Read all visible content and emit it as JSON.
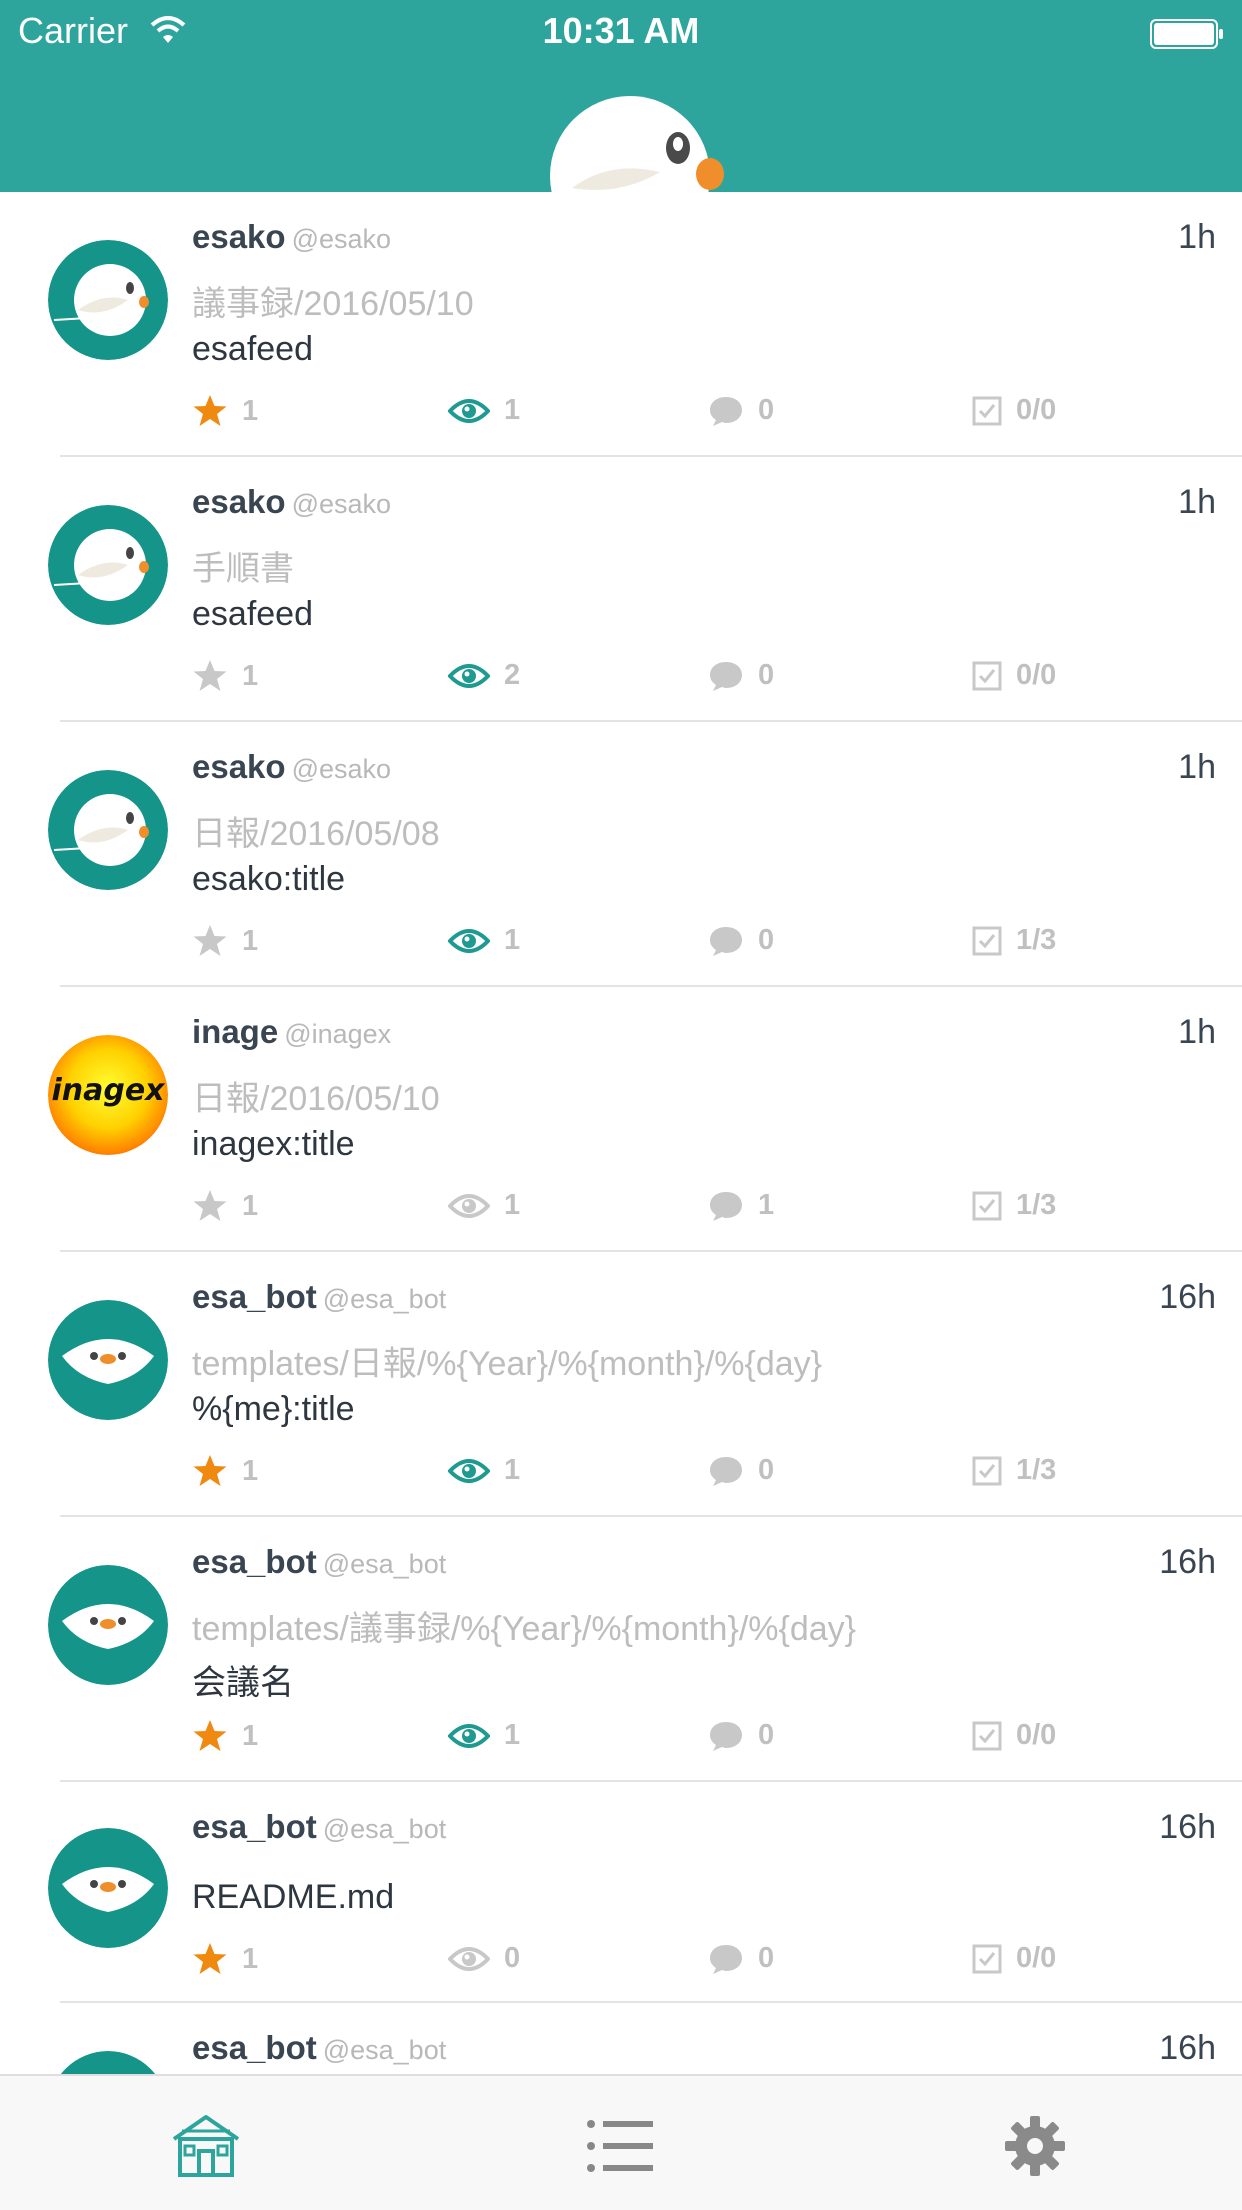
{
  "status_bar": {
    "carrier": "Carrier",
    "time": "10:31 AM"
  },
  "colors": {
    "primary": "#2da59d",
    "star_active": "#f0890f",
    "watch_active": "#1f9a91",
    "inactive": "#c8c8c8"
  },
  "posts": [
    {
      "name": "esako",
      "handle": "@esako",
      "time": "1h",
      "category": "議事録/2016/05/10",
      "title": "esafeed",
      "stars": "1",
      "watchers": "1",
      "comments": "0",
      "tasks": "0/0",
      "starred": true,
      "watched": true,
      "avatar": "esa-bird-icon"
    },
    {
      "name": "esako",
      "handle": "@esako",
      "time": "1h",
      "category": "手順書",
      "title": "esafeed",
      "stars": "1",
      "watchers": "2",
      "comments": "0",
      "tasks": "0/0",
      "starred": false,
      "watched": true,
      "avatar": "esa-bird-icon"
    },
    {
      "name": "esako",
      "handle": "@esako",
      "time": "1h",
      "category": "日報/2016/05/08",
      "title": "esako:title",
      "stars": "1",
      "watchers": "1",
      "comments": "0",
      "tasks": "1/3",
      "starred": false,
      "watched": true,
      "avatar": "esa-bird-icon"
    },
    {
      "name": "inage",
      "handle": "@inagex",
      "time": "1h",
      "category": "日報/2016/05/10",
      "title": "inagex:title",
      "stars": "1",
      "watchers": "1",
      "comments": "1",
      "tasks": "1/3",
      "starred": false,
      "watched": false,
      "avatar": "inagex-logo",
      "avatar_text": "inagex"
    },
    {
      "name": "esa_bot",
      "handle": "@esa_bot",
      "time": "16h",
      "category": "templates/日報/%{Year}/%{month}/%{day}",
      "title": "%{me}:title",
      "stars": "1",
      "watchers": "1",
      "comments": "0",
      "tasks": "1/3",
      "starred": true,
      "watched": true,
      "avatar": "esa-bot-icon"
    },
    {
      "name": "esa_bot",
      "handle": "@esa_bot",
      "time": "16h",
      "category": "templates/議事録/%{Year}/%{month}/%{day}",
      "title": "会議名",
      "stars": "1",
      "watchers": "1",
      "comments": "0",
      "tasks": "0/0",
      "starred": true,
      "watched": true,
      "avatar": "esa-bot-icon"
    },
    {
      "name": "esa_bot",
      "handle": "@esa_bot",
      "time": "16h",
      "category": "",
      "title": "README.md",
      "stars": "1",
      "watchers": "0",
      "comments": "0",
      "tasks": "0/0",
      "starred": true,
      "watched": false,
      "avatar": "esa-bot-icon"
    },
    {
      "name": "esa_bot",
      "handle": "@esa_bot",
      "time": "16h",
      "category": "",
      "title": "",
      "stars": "",
      "watchers": "",
      "comments": "",
      "tasks": "",
      "starred": false,
      "watched": false,
      "avatar": "esa-bot-icon"
    }
  ],
  "tabs": [
    {
      "icon": "home-icon",
      "active": true
    },
    {
      "icon": "list-icon",
      "active": false
    },
    {
      "icon": "gear-icon",
      "active": false
    }
  ]
}
